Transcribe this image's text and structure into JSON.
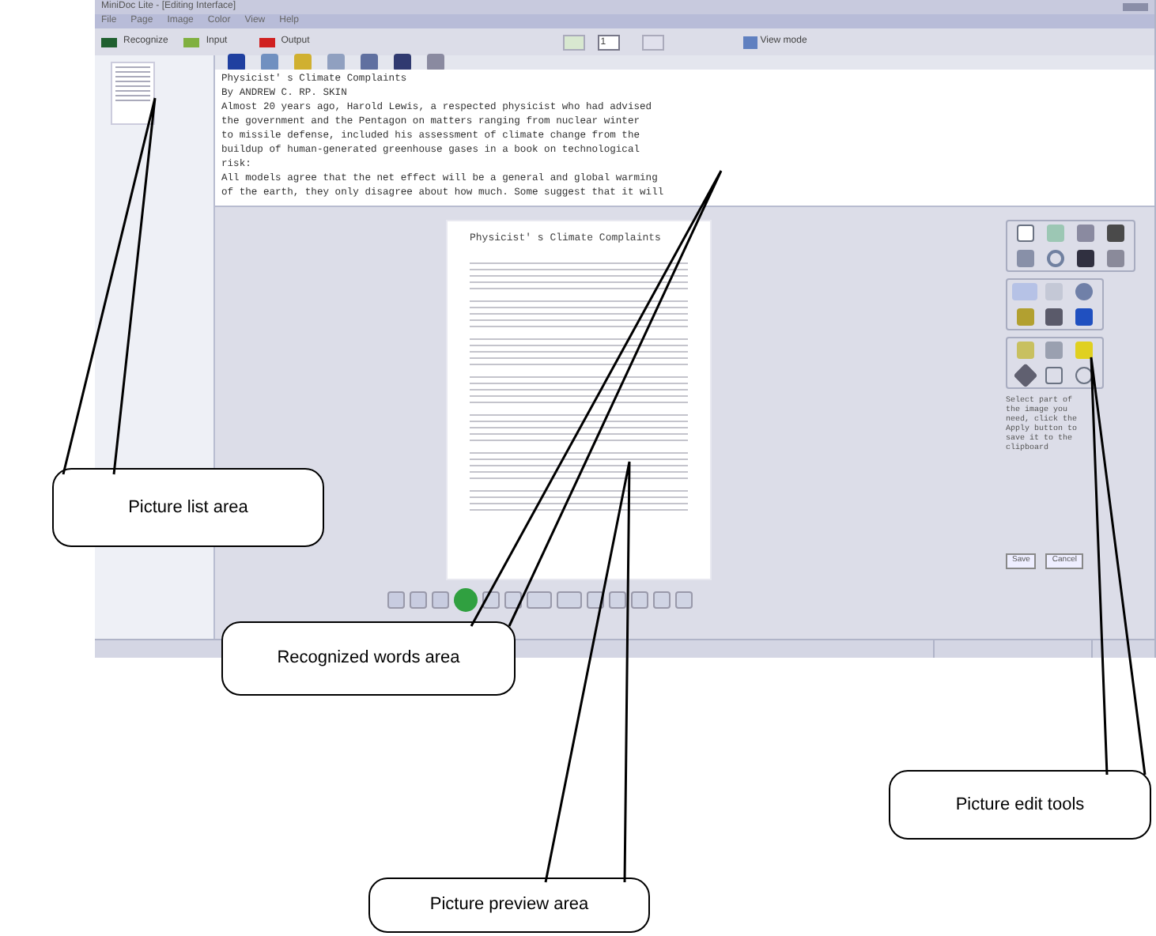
{
  "window": {
    "title": "MiniDoc Lite - [Editing Interface]"
  },
  "menu": [
    "File",
    "Page",
    "Image",
    "Color",
    "View",
    "Help"
  ],
  "toolbar": {
    "buttons": [
      "Recognize",
      "Input",
      "Output"
    ],
    "page_field": {
      "value": "1"
    },
    "view_mode": "View mode"
  },
  "recognized_text": [
    "Physicist' s Climate Complaints",
    "By ANDREW C.  RP. SKIN",
    "Almost 20 years ago, Harold Lewis, a respected physicist who had advised",
    "the government and the Pentagon on matters ranging from  nuclear winter",
    "to missile defense, included his assessment of climate change from the",
    "buildup of human-generated greenhouse gases in a book on technological",
    "risk:",
    "All models agree that the net effect will be a general and global warming",
    "of the earth, they only disagree about how much. Some suggest that it will"
  ],
  "preview": {
    "page_title": "Physicist' s Climate Complaints"
  },
  "edit_tools": {
    "hint": "Select part of the image you need, click the Apply button to save it to the clipboard",
    "buttons": [
      "Save",
      "Cancel"
    ]
  },
  "callouts": [
    {
      "text": "Picture list area"
    },
    {
      "text": "Recognized words area"
    },
    {
      "text": "Picture edit tools"
    },
    {
      "text": "Picture preview area"
    }
  ]
}
